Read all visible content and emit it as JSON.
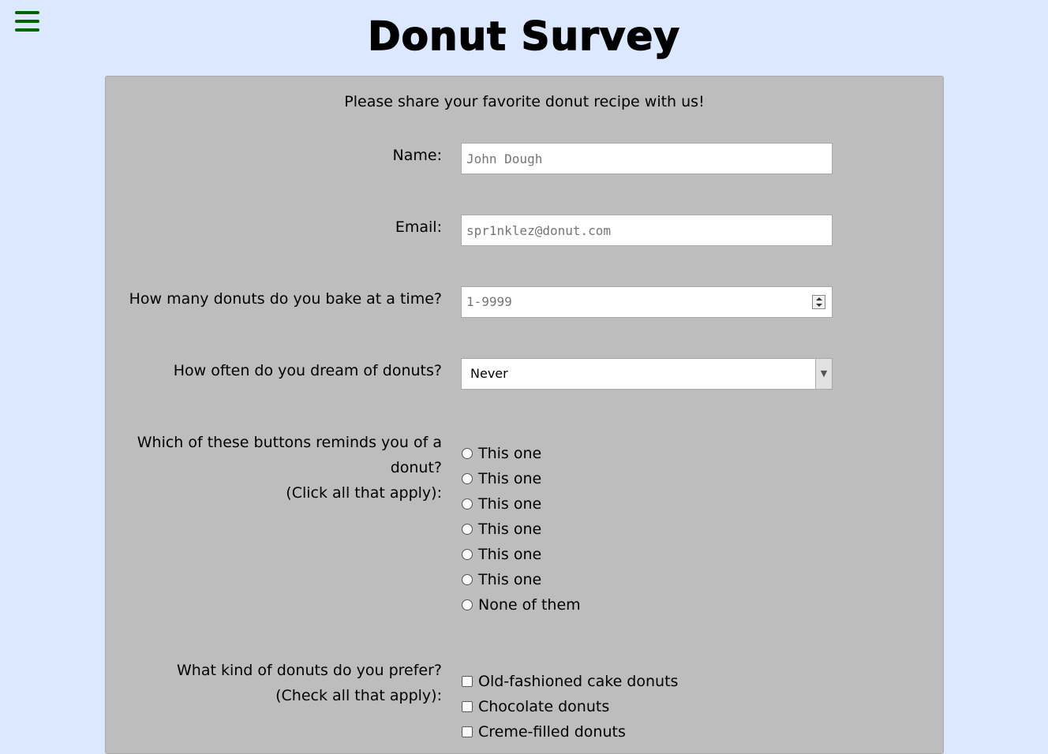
{
  "header": {
    "menu_icon": "hamburger-menu-icon",
    "menu_icon_color": "#006400",
    "title": "Donut Survey"
  },
  "form": {
    "intro": "Please share your favorite donut recipe with us!",
    "name": {
      "label": "Name:",
      "placeholder": "John Dough",
      "value": ""
    },
    "email": {
      "label": "Email:",
      "placeholder": "spr1nklez@donut.com",
      "value": ""
    },
    "count": {
      "label": "How many donuts do you bake at a time?",
      "placeholder": "1-9999",
      "value": ""
    },
    "dream": {
      "label": "How often do you dream of donuts?",
      "selected": "Never"
    },
    "buttons": {
      "label_line1": "Which of these buttons reminds you of a",
      "label_line2": "donut?",
      "label_line3": "(Click all that apply):",
      "options": [
        "This one",
        "This one",
        "This one",
        "This one",
        "This one",
        "This one",
        "None of them"
      ]
    },
    "kinds": {
      "label_line1": "What kind of donuts do you prefer?",
      "label_line2": "(Check all that apply):",
      "options": [
        "Old-fashioned cake donuts",
        "Chocolate donuts",
        "Creme-filled donuts"
      ]
    }
  },
  "colors": {
    "background": "#dce8ff",
    "panel": "#bdbdbd"
  }
}
